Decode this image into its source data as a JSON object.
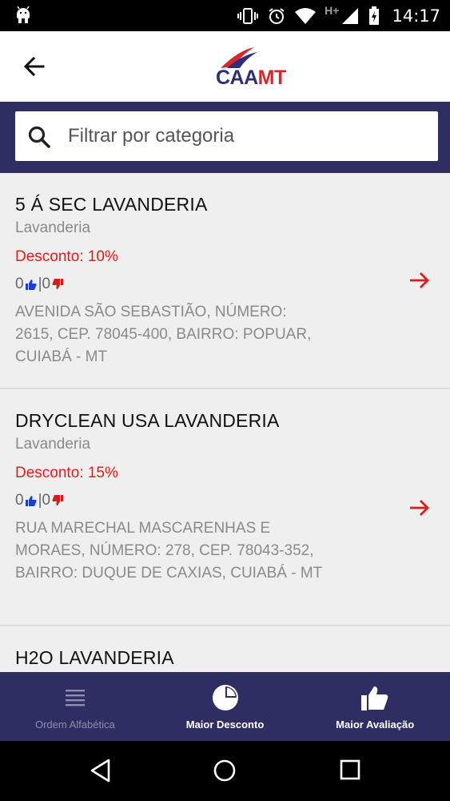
{
  "status_bar": {
    "time": "14:17",
    "network_label": "H+"
  },
  "app_bar": {
    "logo_left": "CAA",
    "logo_right": "MT"
  },
  "search": {
    "placeholder": "Filtrar por categoria"
  },
  "listings": [
    {
      "name": "5 Á SEC LAVANDERIA",
      "category": "Lavanderia",
      "discount": "Desconto: 10%",
      "likes": "0",
      "dislikes": "|0",
      "address": "AVENIDA SÃO SEBASTIÃO, NÚMERO: 2615, CEP. 78045-400, BAIRRO: POPUAR, CUIABÁ - MT"
    },
    {
      "name": "DRYCLEAN USA LAVANDERIA",
      "category": "Lavanderia",
      "discount": "Desconto: 15%",
      "likes": "0",
      "dislikes": "|0",
      "address": "RUA MARECHAL MASCARENHAS E MORAES, NÚMERO: 278, CEP. 78043-352, BAIRRO: DUQUE DE CAXIAS,  CUIABÁ - MT"
    },
    {
      "name": "H2O LAVANDERIA"
    }
  ],
  "bottom_nav": {
    "items": [
      {
        "label": "Ordem Alfabética",
        "icon": "list-icon",
        "active": false
      },
      {
        "label": "Maior Desconto",
        "icon": "pie-chart-icon",
        "active": true
      },
      {
        "label": "Maior Avaliação",
        "icon": "thumbs-up-icon",
        "active": true
      }
    ]
  },
  "colors": {
    "primary": "#2e2e63",
    "discount": "#e01b1b",
    "like": "#1a3fd6",
    "dislike": "#d81b1b"
  }
}
